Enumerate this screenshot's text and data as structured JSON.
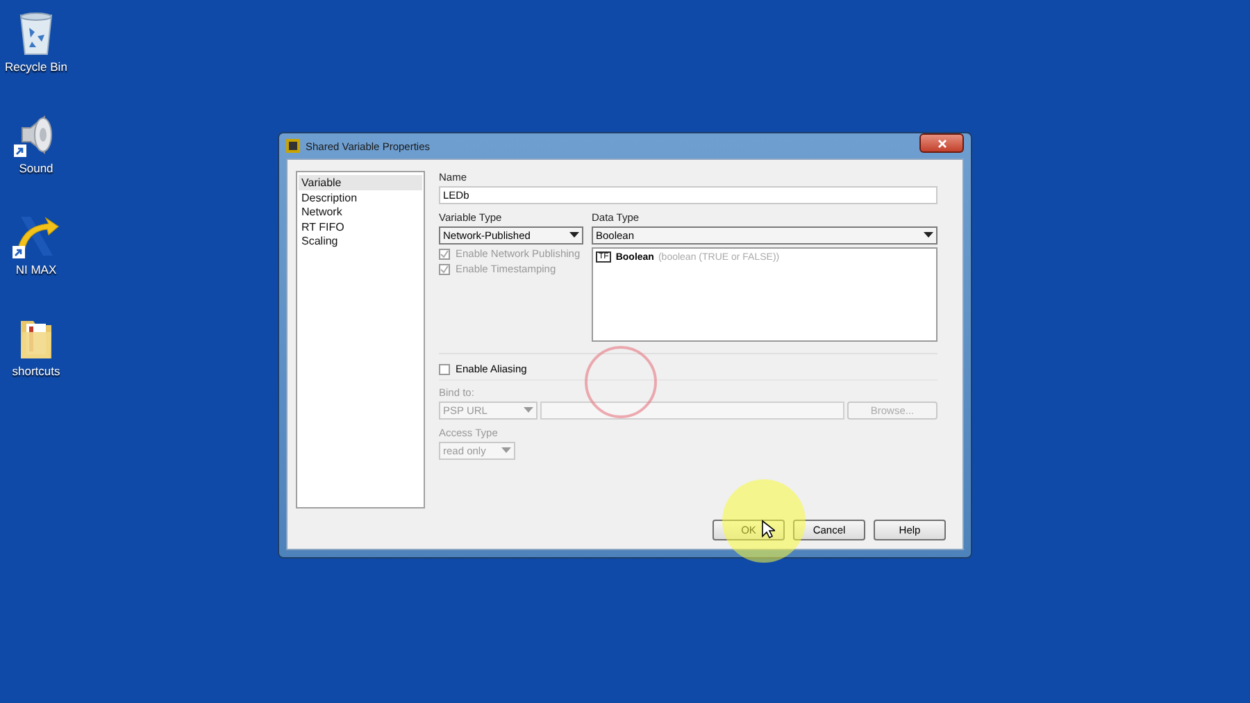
{
  "desktop_icons": [
    {
      "label": "Recycle Bin",
      "kind": "bin",
      "shortcut": false
    },
    {
      "label": "Sound",
      "kind": "speaker",
      "shortcut": true
    },
    {
      "label": "NI MAX",
      "kind": "app",
      "shortcut": true
    },
    {
      "label": "shortcuts",
      "kind": "folder",
      "shortcut": false
    }
  ],
  "dialog": {
    "title": "Shared Variable Properties",
    "categories": [
      {
        "label": "Variable",
        "selected": true
      },
      {
        "label": "Description",
        "selected": false
      },
      {
        "label": "Network",
        "selected": false
      },
      {
        "label": "RT FIFO",
        "selected": false
      },
      {
        "label": "Scaling",
        "selected": false
      }
    ],
    "name": {
      "label": "Name",
      "value": "LEDb"
    },
    "variable_type": {
      "label": "Variable Type",
      "value": "Network-Published"
    },
    "options": [
      {
        "label": "Enable Network Publishing",
        "checked": true,
        "disabled": true
      },
      {
        "label": "Enable Timestamping",
        "checked": true,
        "disabled": true
      }
    ],
    "data_type": {
      "label": "Data Type",
      "value": "Boolean",
      "items": [
        {
          "badge": "TF",
          "name": "Boolean",
          "description": "(boolean (TRUE or FALSE))"
        }
      ]
    },
    "aliasing": {
      "label": "Enable Aliasing",
      "checked": false
    },
    "bind_to": {
      "label": "Bind to:",
      "protocol": "PSP URL",
      "button": "Browse...",
      "disabled": true
    },
    "access_type": {
      "label": "Access Type",
      "value": "read only",
      "disabled": true
    },
    "buttons": [
      {
        "label": "OK"
      },
      {
        "label": "Cancel"
      },
      {
        "label": "Help"
      }
    ]
  }
}
